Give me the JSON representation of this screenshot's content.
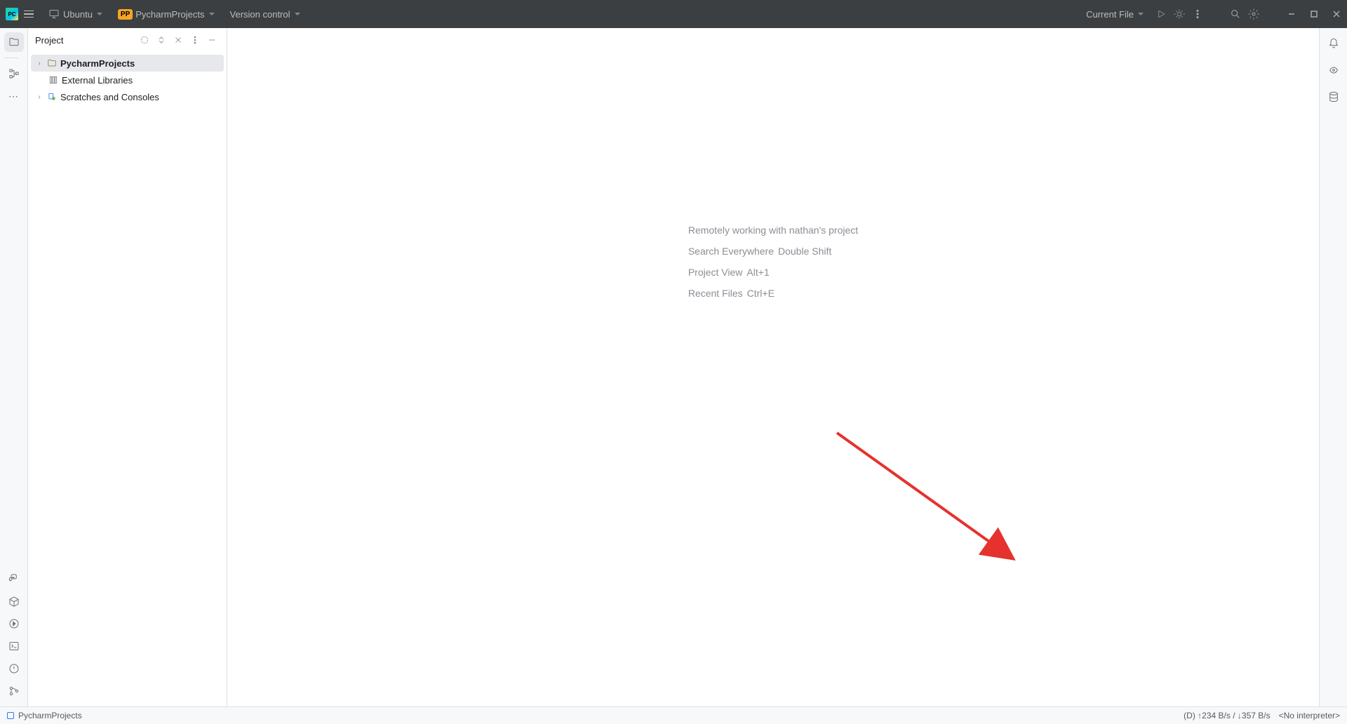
{
  "menubar": {
    "os_label": "Ubuntu",
    "project_badge": "PP",
    "project_name": "PycharmProjects",
    "vcs_label": "Version control",
    "run_config": "Current File"
  },
  "project_panel": {
    "title": "Project",
    "tree": {
      "root": "PycharmProjects",
      "libs": "External Libraries",
      "scratches": "Scratches and Consoles"
    }
  },
  "editor": {
    "hint1": "Remotely working with nathan's project",
    "hint2_label": "Search Everywhere",
    "hint2_key": "Double Shift",
    "hint3_label": "Project View",
    "hint3_key": "Alt+1",
    "hint4_label": "Recent Files",
    "hint4_key": "Ctrl+E"
  },
  "status": {
    "project": "PycharmProjects",
    "net_prefix": "(D)",
    "net_up": "↑234 B/s",
    "net_sep": "/",
    "net_down": "↓357 B/s",
    "interpreter": "<No interpreter>"
  }
}
